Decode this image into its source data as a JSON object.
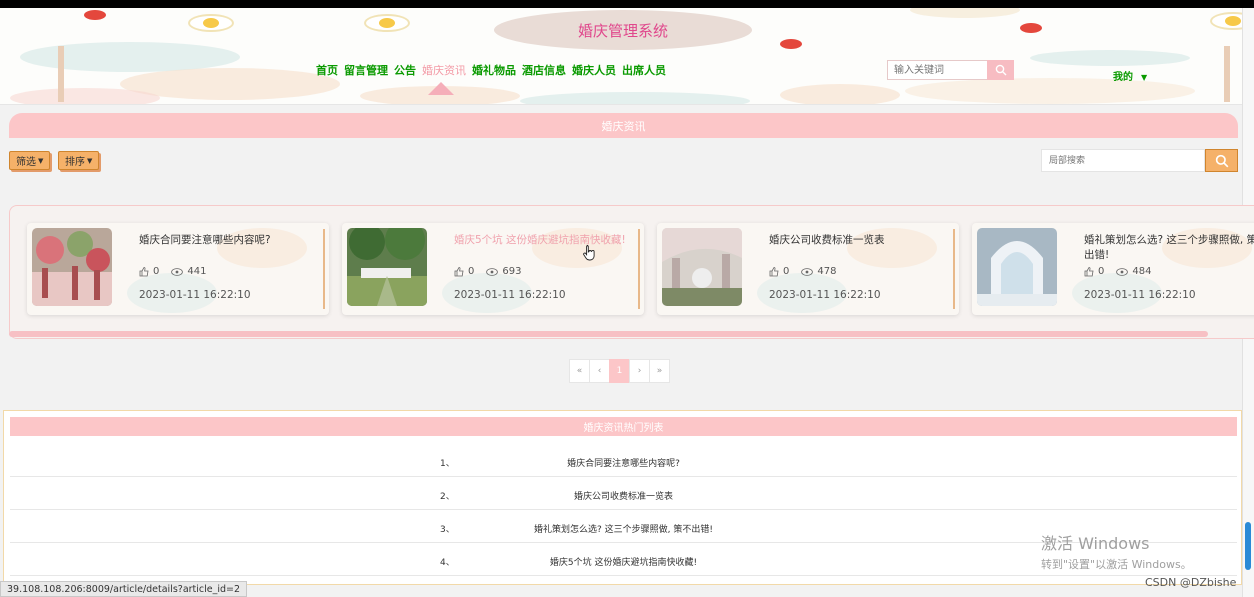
{
  "app": {
    "title": "婚庆管理系统"
  },
  "nav": {
    "items": [
      {
        "label": "首页",
        "active": false
      },
      {
        "label": "留言管理",
        "active": false
      },
      {
        "label": "公告",
        "active": false
      },
      {
        "label": "婚庆资讯",
        "active": true
      },
      {
        "label": "婚礼物品",
        "active": false
      },
      {
        "label": "酒店信息",
        "active": false
      },
      {
        "label": "婚庆人员",
        "active": false
      },
      {
        "label": "出席人员",
        "active": false
      }
    ]
  },
  "search": {
    "placeholder": "输入关键词"
  },
  "user_menu": {
    "label": "我的"
  },
  "section": {
    "title": "婚庆资讯"
  },
  "toolbar": {
    "filter_label": "筛选",
    "sort_label": "排序",
    "local_search_placeholder": "局部搜索"
  },
  "articles": [
    {
      "title": "婚庆合同要注意哪些内容呢?",
      "likes": "0",
      "views": "441",
      "date": "2023-01-11 16:22:10",
      "hover": false
    },
    {
      "title": "婚庆5个坑 这份婚庆避坑指南快收藏!",
      "likes": "0",
      "views": "693",
      "date": "2023-01-11 16:22:10",
      "hover": true
    },
    {
      "title": "婚庆公司收费标准一览表",
      "likes": "0",
      "views": "478",
      "date": "2023-01-11 16:22:10",
      "hover": false
    },
    {
      "title": "婚礼策划怎么选? 这三个步骤照做, 策不出错!",
      "likes": "0",
      "views": "484",
      "date": "2023-01-11 16:22:10",
      "hover": false
    }
  ],
  "pagination": {
    "first": "«",
    "prev": "‹",
    "current": "1",
    "next": "›",
    "last": "»"
  },
  "hot_list": {
    "title": "婚庆资讯热门列表",
    "items": [
      {
        "num": "1、",
        "title": "婚庆合同要注意哪些内容呢?"
      },
      {
        "num": "2、",
        "title": "婚庆公司收费标准一览表"
      },
      {
        "num": "3、",
        "title": "婚礼策划怎么选? 这三个步骤照做, 策不出错!"
      },
      {
        "num": "4、",
        "title": "婚庆5个坑 这份婚庆避坑指南快收藏!"
      }
    ]
  },
  "status_bar": {
    "url": "39.108.108.206:8009/article/details?article_id=2"
  },
  "watermark": {
    "line1": "激活 Windows",
    "line2": "转到\"设置\"以激活 Windows。"
  },
  "csdn": {
    "text": "CSDN @DZbishe"
  },
  "colors": {
    "brand_pink": "#fcc6c8",
    "nav_green": "#0a9a00",
    "accent_orange": "#f5b169",
    "title_pink": "#e0478c"
  },
  "icons": {
    "search": "search-icon",
    "like": "thumb-up-icon",
    "view": "eye-icon",
    "caret": "caret-down-icon"
  }
}
